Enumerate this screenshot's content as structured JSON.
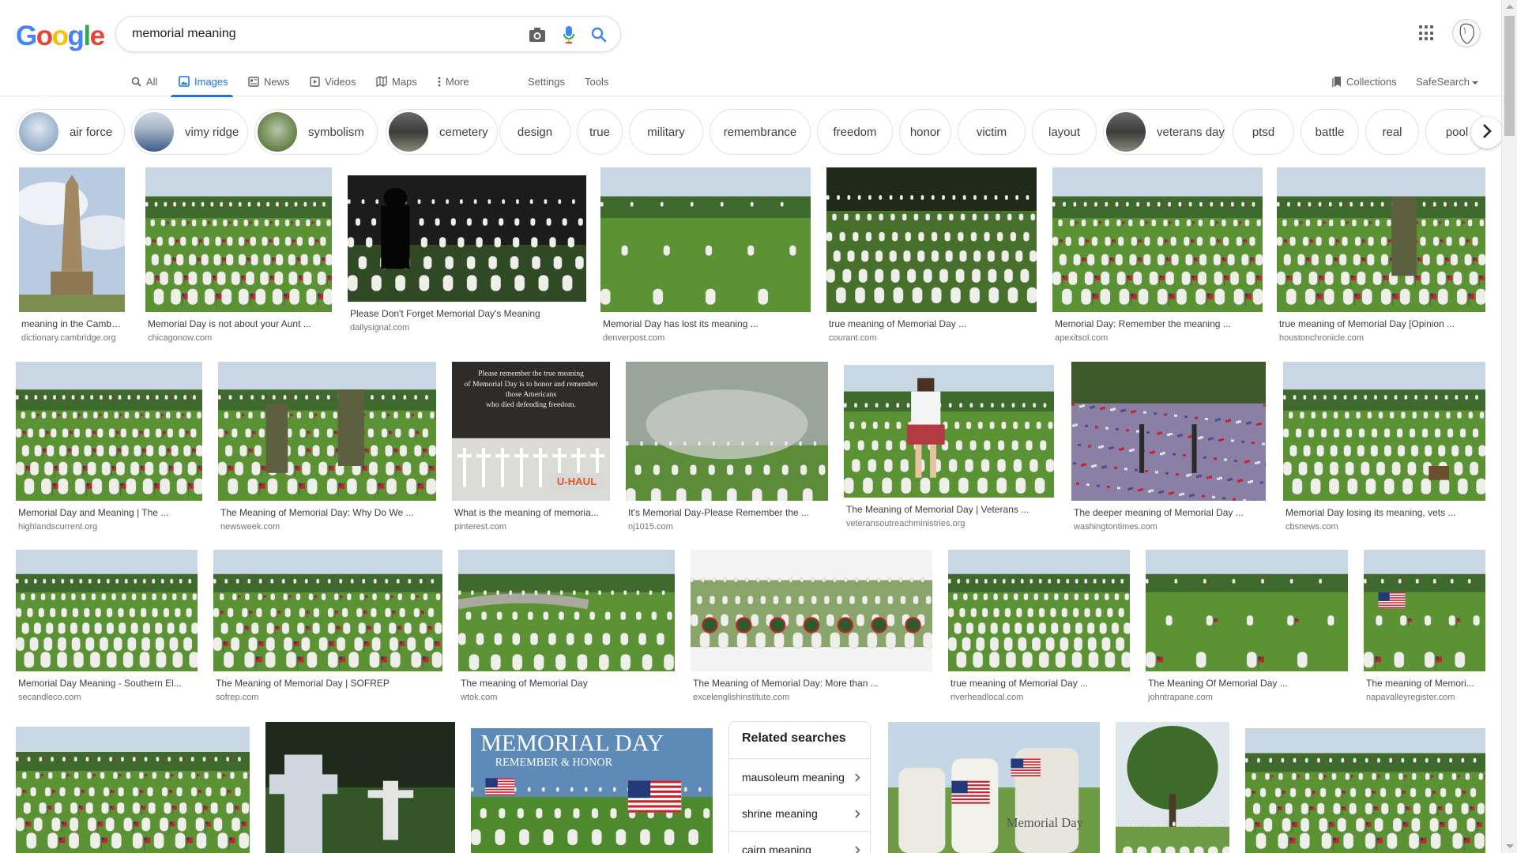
{
  "logo": {
    "text": "Google",
    "letters": [
      "G",
      "o",
      "o",
      "g",
      "l",
      "e"
    ],
    "colors": [
      "#4285F4",
      "#EA4335",
      "#FBBC05",
      "#4285F4",
      "#34A853",
      "#EA4335"
    ]
  },
  "search": {
    "query": "memorial meaning"
  },
  "tabs": [
    {
      "label": "All",
      "icon": "search-icon",
      "active": false
    },
    {
      "label": "Images",
      "icon": "image-icon",
      "active": true
    },
    {
      "label": "News",
      "icon": "news-icon",
      "active": false
    },
    {
      "label": "Videos",
      "icon": "video-icon",
      "active": false
    },
    {
      "label": "Maps",
      "icon": "map-icon",
      "active": false
    },
    {
      "label": "More",
      "icon": "more-vert-icon",
      "active": false
    }
  ],
  "tools": {
    "settings": "Settings",
    "tools": "Tools",
    "collections": "Collections",
    "safesearch": "SafeSearch"
  },
  "chips": [
    {
      "label": "air force",
      "thumb": "sky"
    },
    {
      "label": "vimy ridge",
      "thumb": "monument"
    },
    {
      "label": "symbolism",
      "thumb": "green"
    },
    {
      "label": "cemetery",
      "thumb": "dark"
    },
    {
      "label": "design",
      "thumb": null
    },
    {
      "label": "true",
      "thumb": null
    },
    {
      "label": "military",
      "thumb": null
    },
    {
      "label": "remembrance",
      "thumb": null
    },
    {
      "label": "freedom",
      "thumb": null
    },
    {
      "label": "honor",
      "thumb": null
    },
    {
      "label": "victim",
      "thumb": null
    },
    {
      "label": "layout",
      "thumb": null
    },
    {
      "label": "veterans day",
      "thumb": "dark"
    },
    {
      "label": "ptsd",
      "thumb": null
    },
    {
      "label": "battle",
      "thumb": null
    },
    {
      "label": "real",
      "thumb": null
    },
    {
      "label": "pool",
      "thumb": null
    }
  ],
  "results": [
    {
      "title": "meaning in the Cambri...",
      "site": "dictionary.cambridge.org",
      "scene": "obelisk"
    },
    {
      "title": "Memorial Day is not about your Aunt ...",
      "site": "chicagonow.com",
      "scene": "field-flags"
    },
    {
      "title": "Please Don't Forget Memorial Day's Meaning",
      "site": "dailysignal.com",
      "scene": "silhouette"
    },
    {
      "title": "Memorial Day has lost its meaning ...",
      "site": "denverpost.com",
      "scene": "close-stones"
    },
    {
      "title": "true meaning of Memorial Day ...",
      "site": "courant.com",
      "scene": "dark-rows"
    },
    {
      "title": "Memorial Day: Remember the meaning ...",
      "site": "apexitsol.com",
      "scene": "rows-flags"
    },
    {
      "title": "true meaning of Memorial Day [Opinion ...",
      "site": "houstonchronicle.com",
      "scene": "soldier"
    },
    {
      "title": "Memorial Day and Meaning | The ...",
      "site": "highlandscurrent.org",
      "scene": "rows-flags"
    },
    {
      "title": "The Meaning of Memorial Day: Why Do We ...",
      "site": "newsweek.com",
      "scene": "soldiers"
    },
    {
      "title": "What is the meaning of memoria...",
      "site": "pinterest.com",
      "scene": "quote-card",
      "caption_lines": [
        "Please remember the true meaning",
        "of Memorial Day is to honor and remember",
        "those Americans",
        "who died defending freedom."
      ]
    },
    {
      "title": "It's Memorial Day-Please Remember the ...",
      "site": "nj1015.com",
      "scene": "smoke"
    },
    {
      "title": "The Meaning of Memorial Day | Veterans ...",
      "site": "veteransoutreachministries.org",
      "scene": "girl"
    },
    {
      "title": "The deeper meaning of Memorial Day ...",
      "site": "washingtontimes.com",
      "scene": "flag-field"
    },
    {
      "title": "Memorial Day losing its meaning, vets ...",
      "site": "cbsnews.com",
      "scene": "rows-dog"
    },
    {
      "title": "Memorial Day Meaning - Southern El...",
      "site": "secandleco.com",
      "scene": "wide-rows"
    },
    {
      "title": "The Meaning of Memorial Day | SOFREP",
      "site": "sofrep.com",
      "scene": "rows-flags"
    },
    {
      "title": "The meaning of Memorial Day",
      "site": "wtok.com",
      "scene": "road-rows"
    },
    {
      "title": "The Meaning of Memorial Day: More than ...",
      "site": "excelenglishinstitute.com",
      "scene": "wreaths"
    },
    {
      "title": "true meaning of Memorial Day ...",
      "site": "riverheadlocal.com",
      "scene": "trees-rows"
    },
    {
      "title": "The Meaning Of Memorial Day ...",
      "site": "johntrapane.com",
      "scene": "close-flags"
    },
    {
      "title": "The meaning of Memori...",
      "site": "napavalleyregister.com",
      "scene": "single-flag"
    },
    {
      "title": "",
      "site": "",
      "scene": "rows-flags"
    },
    {
      "title": "",
      "site": "",
      "scene": "crosses"
    },
    {
      "title": "",
      "site": "",
      "scene": "banner",
      "banner_text": [
        "MEMORIAL DAY",
        "REMEMBER & HONOR"
      ]
    },
    {
      "title": "",
      "site": "",
      "scene": "card-memorial",
      "banner_text": [
        "Memorial Day"
      ]
    },
    {
      "title": "",
      "site": "",
      "scene": "tree"
    },
    {
      "title": "",
      "site": "",
      "scene": "rows-flags"
    }
  ],
  "related": {
    "heading": "Related searches",
    "items": [
      "mausoleum meaning",
      "shrine meaning",
      "cairn meaning"
    ]
  },
  "colors": {
    "accent": "#1a73e8",
    "grass": "#4f8a2f",
    "stone": "#e8e8e4",
    "flag_red": "#c8232c",
    "flag_blue": "#243a78"
  }
}
